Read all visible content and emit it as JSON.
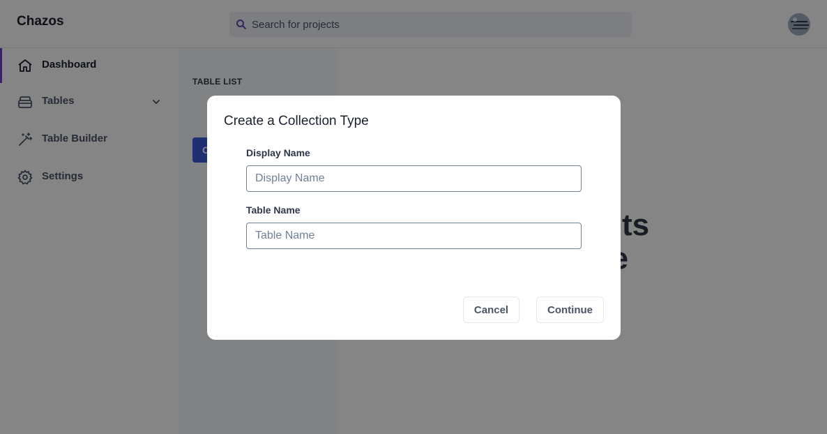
{
  "app": {
    "brand": "Chazos"
  },
  "search": {
    "placeholder": "Search for projects"
  },
  "sidebar": {
    "items": [
      {
        "label": "Dashboard",
        "icon": "home-icon",
        "active": true
      },
      {
        "label": "Tables",
        "icon": "tables-icon",
        "has_chevron": true
      },
      {
        "label": "Table Builder",
        "icon": "magic-wand-icon"
      },
      {
        "label": "Settings",
        "icon": "gear-icon"
      }
    ]
  },
  "table_panel": {
    "heading": "TABLE LIST",
    "button_label": "C"
  },
  "main": {
    "empty_line1": "o view its",
    "empty_line2": "ate one"
  },
  "modal": {
    "title": "Create a Collection Type",
    "display_name": {
      "label": "Display Name",
      "placeholder": "Display Name",
      "value": ""
    },
    "table_name": {
      "label": "Table Name",
      "placeholder": "Table Name",
      "value": ""
    },
    "cancel_label": "Cancel",
    "continue_label": "Continue"
  },
  "colors": {
    "accent": "#6b46c1",
    "primary_button": "#3b5bdb",
    "overlay": "rgba(0,0,0,0.48)"
  }
}
